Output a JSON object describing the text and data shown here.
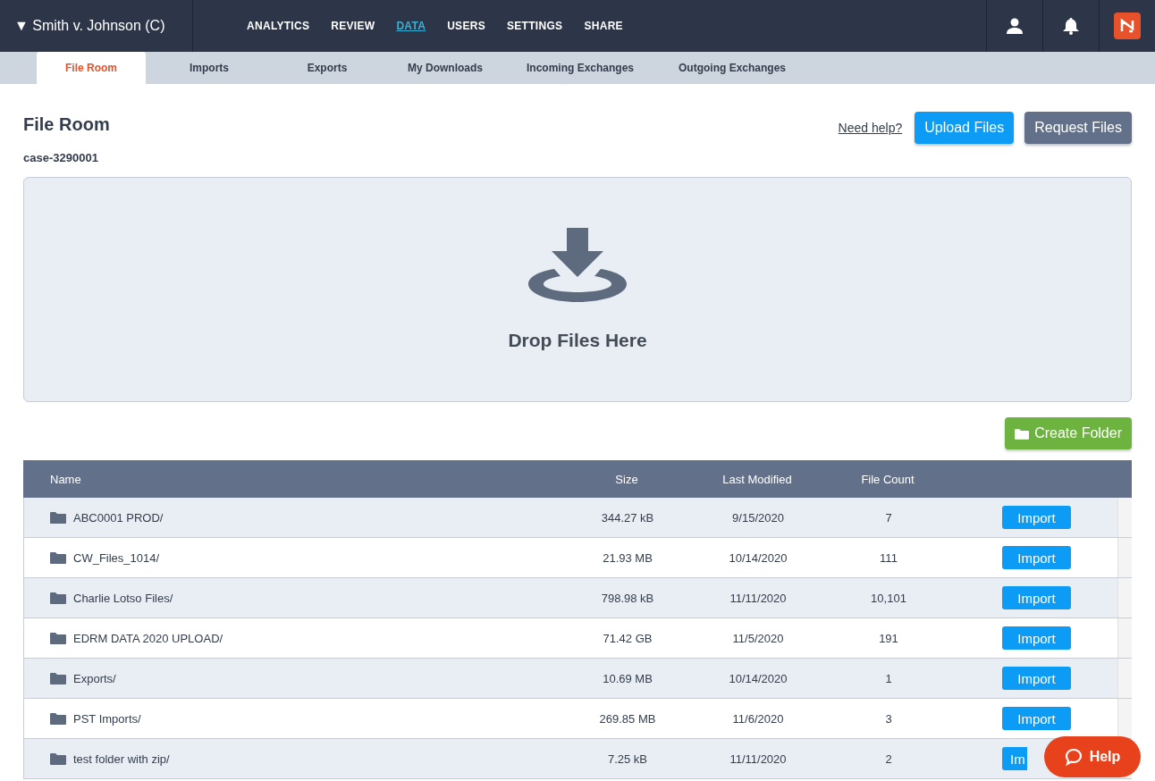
{
  "case_switcher": {
    "caret": "▼",
    "label": "Smith v. Johnson (C)"
  },
  "nav": [
    {
      "label": "ANALYTICS",
      "selected": false
    },
    {
      "label": "REVIEW",
      "selected": false
    },
    {
      "label": "DATA",
      "selected": true
    },
    {
      "label": "USERS",
      "selected": false
    },
    {
      "label": "SETTINGS",
      "selected": false
    },
    {
      "label": "SHARE",
      "selected": false
    }
  ],
  "tabs": [
    {
      "label": "File Room",
      "selected": true
    },
    {
      "label": "Imports",
      "selected": false
    },
    {
      "label": "Exports",
      "selected": false
    },
    {
      "label": "My Downloads",
      "selected": false
    },
    {
      "label": "Incoming Exchanges",
      "selected": false
    },
    {
      "label": "Outgoing Exchanges",
      "selected": false
    }
  ],
  "page": {
    "title": "File Room",
    "subtitle": "case-3290001",
    "help_link": "Need help?",
    "upload_button": "Upload Files",
    "request_button": "Request Files"
  },
  "dropzone": {
    "label": "Drop Files Here"
  },
  "create_folder_button": "Create Folder",
  "table": {
    "columns": [
      "Name",
      "Size",
      "Last Modified",
      "File Count"
    ],
    "rows": [
      {
        "name": "ABC0001 PROD/",
        "size": "344.27 kB",
        "modified": "9/15/2020",
        "count": "7",
        "action": "Import"
      },
      {
        "name": "CW_Files_1014/",
        "size": "21.93 MB",
        "modified": "10/14/2020",
        "count": "111",
        "action": "Import"
      },
      {
        "name": "Charlie Lotso Files/",
        "size": "798.98 kB",
        "modified": "11/11/2020",
        "count": "10,101",
        "action": "Import"
      },
      {
        "name": "EDRM DATA 2020 UPLOAD/",
        "size": "71.42 GB",
        "modified": "11/5/2020",
        "count": "191",
        "action": "Import"
      },
      {
        "name": "Exports/",
        "size": "10.69 MB",
        "modified": "10/14/2020",
        "count": "1",
        "action": "Import"
      },
      {
        "name": "PST Imports/",
        "size": "269.85 MB",
        "modified": "11/6/2020",
        "count": "3",
        "action": "Import"
      },
      {
        "name": "test folder with zip/",
        "size": "7.25 kB",
        "modified": "11/11/2020",
        "count": "2",
        "action": "Im"
      }
    ]
  },
  "help_button": "Help"
}
